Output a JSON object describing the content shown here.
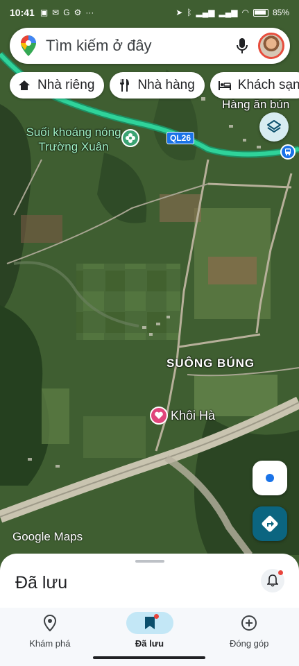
{
  "status_bar": {
    "time": "10:41",
    "battery": "85%"
  },
  "search": {
    "placeholder": "Tìm kiếm ở đây"
  },
  "chips": [
    {
      "label": "Nhà riêng",
      "icon": "home-icon"
    },
    {
      "label": "Nhà hàng",
      "icon": "restaurant-icon"
    },
    {
      "label": "Khách sạn",
      "icon": "hotel-icon"
    }
  ],
  "map": {
    "labels": {
      "hang_an_bun": "Hàng ăn bún",
      "suoi_khoang_line1": "Suối khoáng nóng",
      "suoi_khoang_line2": "Trường Xuân",
      "suong_bung": "SUÔNG BÚNG",
      "khoi_ha": "Khôi Hà"
    },
    "road_shield": "QL26",
    "watermark": "Google Maps"
  },
  "sheet": {
    "title": "Đã lưu"
  },
  "bottom_nav": [
    {
      "label": "Khám phá",
      "icon": "location-pin-icon",
      "active": false
    },
    {
      "label": "Đã lưu",
      "icon": "bookmark-icon",
      "active": true
    },
    {
      "label": "Đóng góp",
      "icon": "add-circle-icon",
      "active": false
    }
  ],
  "colors": {
    "accent": "#1a73e8",
    "active_nav": "#c3e7f6",
    "road": "#2fd39a",
    "directions": "#0b6580",
    "poi_pink": "#e0457b",
    "poi_green": "#3ba373"
  }
}
